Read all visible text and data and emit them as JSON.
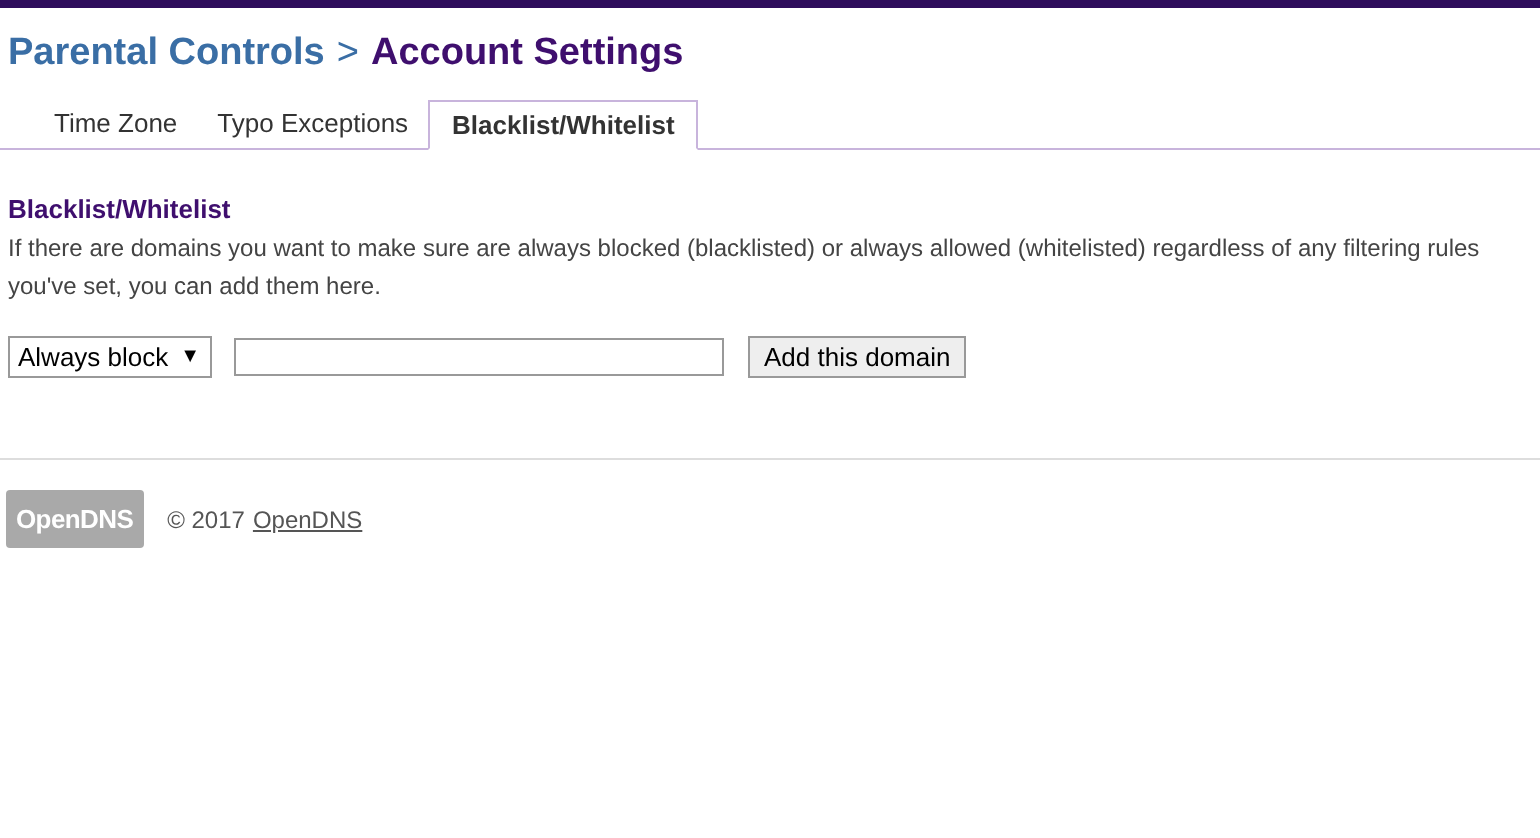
{
  "breadcrumb": {
    "parent": "Parental Controls",
    "separator": ">",
    "current": "Account Settings"
  },
  "tabs": [
    {
      "label": "Time Zone",
      "selected": false
    },
    {
      "label": "Typo Exceptions",
      "selected": false
    },
    {
      "label": "Blacklist/Whitelist",
      "selected": true
    }
  ],
  "section": {
    "title": "Blacklist/Whitelist",
    "description": "If there are domains you want to make sure are always blocked (blacklisted) or always allowed (whitelisted) regardless of any filtering rules you've set, you can add them here."
  },
  "form": {
    "mode_select": {
      "value": "Always block",
      "arrow": "▼"
    },
    "add_button": "Add this domain"
  },
  "footer": {
    "logo": "OpenDNS",
    "copyright": "© 2017",
    "link": "OpenDNS"
  }
}
